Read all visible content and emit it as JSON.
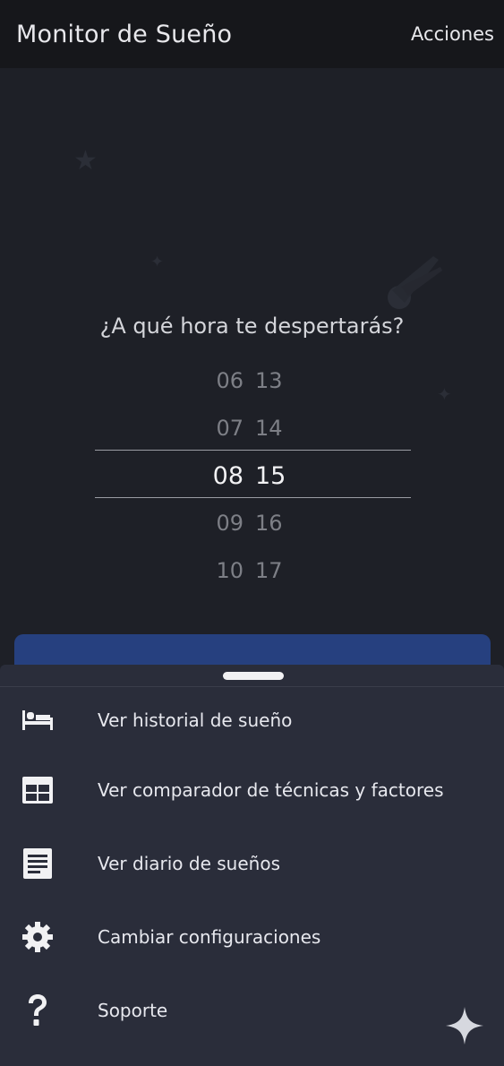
{
  "app_bar": {
    "title": "Monitor de Sueño",
    "actions_label": "Acciones"
  },
  "main": {
    "question": "¿A qué hora te despertarás?",
    "picker": {
      "rows": [
        {
          "hour": "06",
          "minute": "13"
        },
        {
          "hour": "07",
          "minute": "14"
        },
        {
          "hour": "08",
          "minute": "15"
        },
        {
          "hour": "09",
          "minute": "16"
        },
        {
          "hour": "10",
          "minute": "17"
        }
      ],
      "selected_hour": "08",
      "selected_minute": "15"
    }
  },
  "menu": {
    "items": [
      {
        "label": "Ver historial de sueño",
        "icon": "bed-icon"
      },
      {
        "label": "Ver comparador de técnicas y factores",
        "icon": "table-grid-icon"
      },
      {
        "label": "Ver diario de sueños",
        "icon": "notes-icon"
      },
      {
        "label": "Cambiar configuraciones",
        "icon": "gear-icon"
      },
      {
        "label": "Soporte",
        "icon": "help-icon"
      }
    ]
  },
  "colors": {
    "app_bar_bg": "#16171b",
    "background": "#1e2027",
    "sheet_bg": "#2a2d3a",
    "cta_blue": "#26407f",
    "text": "#e7e8ee"
  }
}
